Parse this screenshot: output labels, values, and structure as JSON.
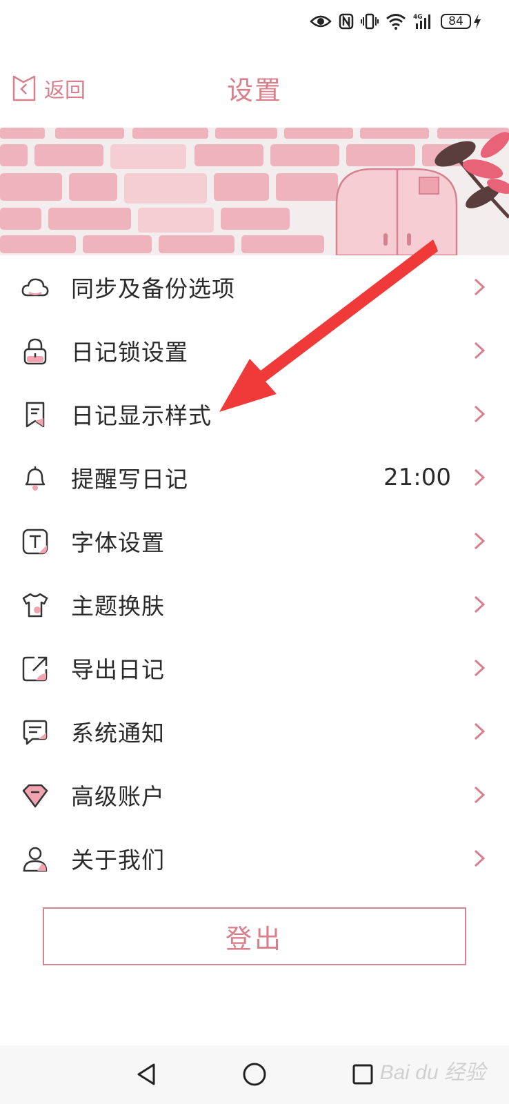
{
  "status_bar": {
    "battery": "84"
  },
  "header": {
    "back_label": "返回",
    "title": "设置"
  },
  "menu": [
    {
      "label": "同步及备份选项",
      "value": ""
    },
    {
      "label": "日记锁设置",
      "value": ""
    },
    {
      "label": "日记显示样式",
      "value": ""
    },
    {
      "label": "提醒写日记",
      "value": "21:00"
    },
    {
      "label": "字体设置",
      "value": ""
    },
    {
      "label": "主题换肤",
      "value": ""
    },
    {
      "label": "导出日记",
      "value": ""
    },
    {
      "label": "系统通知",
      "value": ""
    },
    {
      "label": "高级账户",
      "value": ""
    },
    {
      "label": "关于我们",
      "value": ""
    }
  ],
  "logout_label": "登出",
  "watermark": "Bai du 经验",
  "colors": {
    "accent": "#d97f8c",
    "icon_fill": "#f2a3b0",
    "arrow": "#f03a3a"
  }
}
